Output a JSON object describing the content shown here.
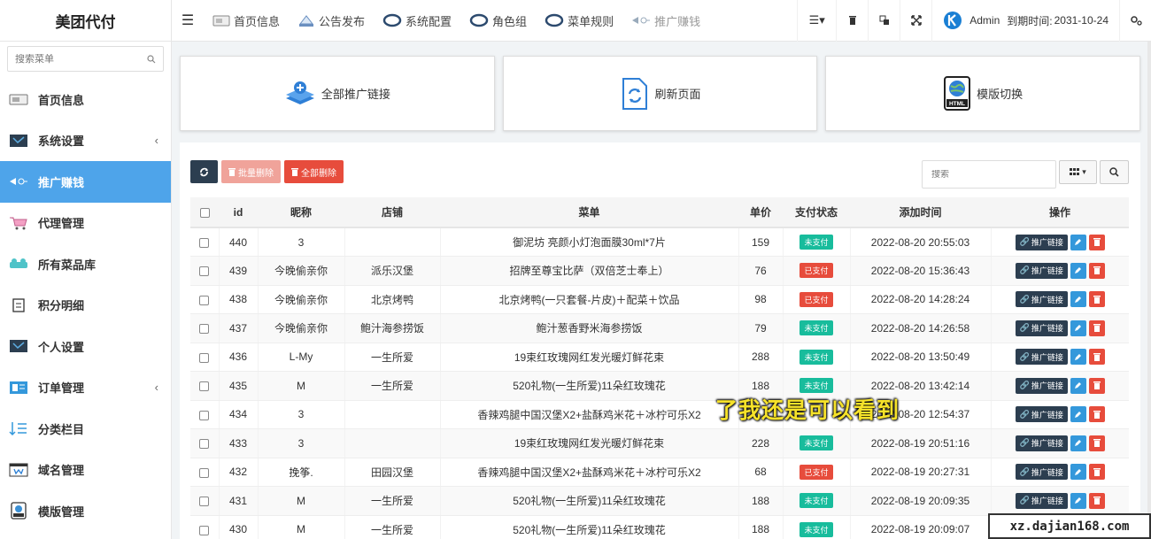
{
  "brand": {
    "title": "美团代付"
  },
  "topnav": {
    "items": [
      {
        "label": "首页信息",
        "icon": "home-card-icon"
      },
      {
        "label": "公告发布",
        "icon": "megaphone-icon"
      },
      {
        "label": "系统配置",
        "icon": "ring-icon"
      },
      {
        "label": "角色组",
        "icon": "ring-icon"
      },
      {
        "label": "菜单规则",
        "icon": "ring-icon"
      },
      {
        "label": "推广赚钱",
        "icon": "promote-icon"
      }
    ],
    "user": {
      "name": "Admin",
      "expire_label": "到期时间:",
      "expire_date": "2031-10-24"
    }
  },
  "sidebar": {
    "search_placeholder": "搜索菜单",
    "items": [
      {
        "label": "首页信息",
        "icon": "home-card-icon",
        "active": false,
        "caret": ""
      },
      {
        "label": "系统设置",
        "icon": "settings-panel-icon",
        "active": false,
        "caret": "‹"
      },
      {
        "label": "推广赚钱",
        "icon": "promote-icon",
        "active": true,
        "caret": ""
      },
      {
        "label": "代理管理",
        "icon": "cart-icon",
        "active": false,
        "caret": ""
      },
      {
        "label": "所有菜品库",
        "icon": "dishes-icon",
        "active": false,
        "caret": ""
      },
      {
        "label": "积分明细",
        "icon": "points-icon",
        "active": false,
        "caret": ""
      },
      {
        "label": "个人设置",
        "icon": "profile-panel-icon",
        "active": false,
        "caret": ""
      },
      {
        "label": "订单管理",
        "icon": "order-icon",
        "active": false,
        "caret": "‹"
      },
      {
        "label": "分类栏目",
        "icon": "sort-icon",
        "active": false,
        "caret": ""
      },
      {
        "label": "域名管理",
        "icon": "domain-icon",
        "active": false,
        "caret": ""
      },
      {
        "label": "模版管理",
        "icon": "template-icon",
        "active": false,
        "caret": ""
      }
    ]
  },
  "cards": [
    {
      "label": "全部推广链接",
      "icon": "layers-plus-icon"
    },
    {
      "label": "刷新页面",
      "icon": "refresh-doc-icon"
    },
    {
      "label": "模版切换",
      "icon": "html-globe-icon"
    }
  ],
  "toolbar": {
    "batch_delete": "批量删除",
    "delete_all": "全部删除",
    "search_placeholder": "搜索"
  },
  "table": {
    "headers": [
      "",
      "id",
      "昵称",
      "店铺",
      "菜单",
      "单价",
      "支付状态",
      "添加时间",
      "操作"
    ],
    "link_label": "推广链接",
    "rows": [
      {
        "id": "440",
        "nick": "3",
        "shop": "",
        "menu": "御泥坊 亮颜小灯泡面膜30ml*7片",
        "price": "159",
        "status": "未支付",
        "paid": false,
        "time": "2022-08-20 20:55:03"
      },
      {
        "id": "439",
        "nick": "今晚偷亲你",
        "shop": "派乐汉堡",
        "menu": "招牌至尊宝比萨（双倍芝士奉上）",
        "price": "76",
        "status": "已支付",
        "paid": true,
        "time": "2022-08-20 15:36:43"
      },
      {
        "id": "438",
        "nick": "今晚偷亲你",
        "shop": "北京烤鸭",
        "menu": "北京烤鸭(一只套餐-片皮)＋配菜＋饮品",
        "price": "98",
        "status": "已支付",
        "paid": true,
        "time": "2022-08-20 14:28:24"
      },
      {
        "id": "437",
        "nick": "今晚偷亲你",
        "shop": "鲍汁海参捞饭",
        "menu": "鲍汁葱香野米海参捞饭",
        "price": "79",
        "status": "未支付",
        "paid": false,
        "time": "2022-08-20 14:26:58"
      },
      {
        "id": "436",
        "nick": "L-My",
        "shop": "一生所爱",
        "menu": "19束红玫瑰网红发光暖灯鲜花束",
        "price": "288",
        "status": "未支付",
        "paid": false,
        "time": "2022-08-20 13:50:49"
      },
      {
        "id": "435",
        "nick": "M",
        "shop": "一生所爱",
        "menu": "520礼物(一生所爱)11朵红玫瑰花",
        "price": "188",
        "status": "未支付",
        "paid": false,
        "time": "2022-08-20 13:42:14"
      },
      {
        "id": "434",
        "nick": "3",
        "shop": "",
        "menu": "香辣鸡腿中国汉堡X2+盐酥鸡米花＋冰柠可乐X2",
        "price": "",
        "status": "",
        "paid": false,
        "time": "2022-08-20 12:54:37"
      },
      {
        "id": "433",
        "nick": "3",
        "shop": "",
        "menu": "19束红玫瑰网红发光暖灯鲜花束",
        "price": "228",
        "status": "未支付",
        "paid": false,
        "time": "2022-08-19 20:51:16"
      },
      {
        "id": "432",
        "nick": "挽筝.",
        "shop": "田园汉堡",
        "menu": "香辣鸡腿中国汉堡X2+盐酥鸡米花＋冰柠可乐X2",
        "price": "68",
        "status": "已支付",
        "paid": true,
        "time": "2022-08-19 20:27:31"
      },
      {
        "id": "431",
        "nick": "M",
        "shop": "一生所爱",
        "menu": "520礼物(一生所爱)11朵红玫瑰花",
        "price": "188",
        "status": "未支付",
        "paid": false,
        "time": "2022-08-19 20:09:35"
      },
      {
        "id": "430",
        "nick": "M",
        "shop": "一生所爱",
        "menu": "520礼物(一生所爱)11朵红玫瑰花",
        "price": "188",
        "status": "未支付",
        "paid": false,
        "time": "2022-08-19 20:09:07"
      }
    ]
  },
  "overlay": {
    "caption": "了我还是可以看到"
  },
  "watermark": {
    "text": "xz.dajian168.com"
  },
  "colors": {
    "active": "#4ea4ea",
    "dark": "#2c3e50",
    "red": "#e74c3c",
    "green": "#18bc9c"
  }
}
